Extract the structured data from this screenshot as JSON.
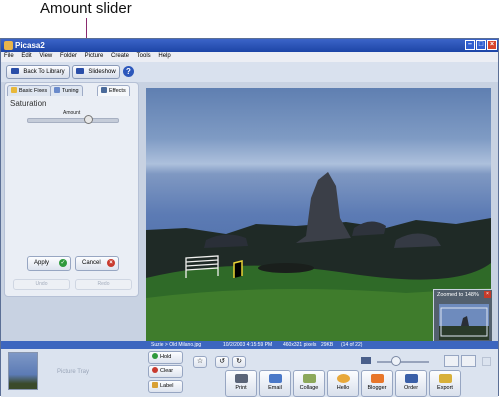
{
  "callout": "Amount slider",
  "window": {
    "title": "Picasa2"
  },
  "menu": [
    "File",
    "Edit",
    "View",
    "Folder",
    "Picture",
    "Create",
    "Tools",
    "Help"
  ],
  "toolbar": {
    "back_label": "Back To Library",
    "slideshow_label": "Slideshow",
    "help_label": "?"
  },
  "tabs": {
    "basic": "Basic Fixes",
    "tuning": "Tuning",
    "effects": "Effects"
  },
  "effect": {
    "name": "Saturation",
    "amount_label": "Amount",
    "amount_value": 0.73
  },
  "panel_buttons": {
    "apply": "Apply",
    "cancel": "Cancel",
    "undo": "Undo",
    "redo": "Redo"
  },
  "zoom": {
    "label": "Zoomed to 148%"
  },
  "status": {
    "path": "Suzie > Old Milano.jpg",
    "date": "10/2/2003 4:15:59 PM",
    "dims": "460x321 pixels",
    "size": "29KB",
    "index": "(14 of 22)"
  },
  "tray": {
    "label": "Picture Tray",
    "hold": "Hold",
    "clear": "Clear",
    "label_btn": "Label"
  },
  "actions": [
    "Print",
    "Email",
    "Collage",
    "Hello",
    "Blogger",
    "Order",
    "Export"
  ]
}
